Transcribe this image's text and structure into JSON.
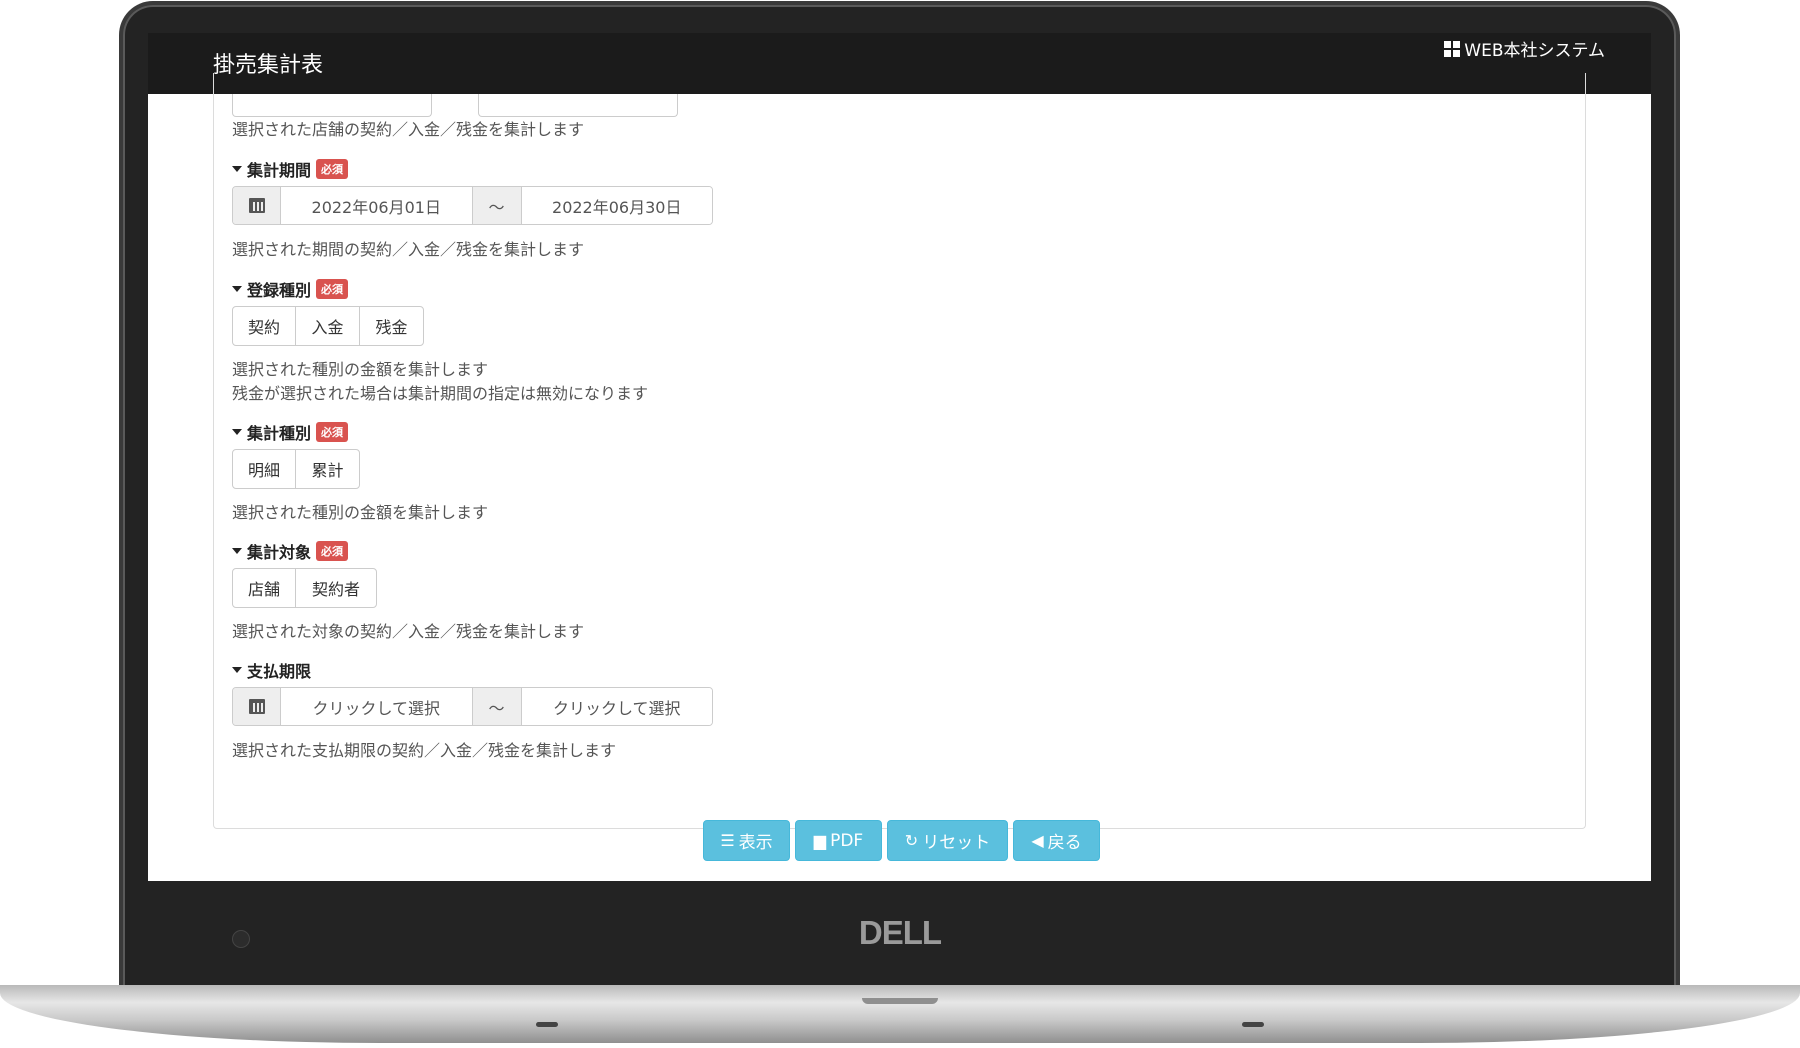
{
  "header": {
    "title": "掛売集計表",
    "system_name": "WEB本社システム"
  },
  "form": {
    "store_help": "選択された店舗の契約／入金／残金を集計します",
    "period": {
      "label": "集計期間",
      "required_badge": "必須",
      "start": "2022年06月01日",
      "separator": "～",
      "end": "2022年06月30日",
      "help": "選択された期間の契約／入金／残金を集計します"
    },
    "registration_type": {
      "label": "登録種別",
      "required_badge": "必須",
      "options": [
        "契約",
        "入金",
        "残金"
      ],
      "help_1": "選択された種別の金額を集計します",
      "help_2": "残金が選択された場合は集計期間の指定は無効になります"
    },
    "aggregation_type": {
      "label": "集計種別",
      "required_badge": "必須",
      "options": [
        "明細",
        "累計"
      ],
      "help": "選択された種別の金額を集計します"
    },
    "target": {
      "label": "集計対象",
      "required_badge": "必須",
      "options": [
        "店舗",
        "契約者"
      ],
      "help": "選択された対象の契約／入金／残金を集計します"
    },
    "payment_deadline": {
      "label": "支払期限",
      "start_placeholder": "クリックして選択",
      "separator": "～",
      "end_placeholder": "クリックして選択",
      "help": "選択された支払期限の契約／入金／残金を集計します"
    }
  },
  "actions": {
    "show": "表示",
    "pdf": "PDF",
    "reset": "リセット",
    "back": "戻る"
  },
  "device": {
    "brand": "DELL"
  },
  "colors": {
    "header_bg": "#1b1b1b",
    "badge": "#d9534f",
    "info_button": "#5bc0de"
  }
}
